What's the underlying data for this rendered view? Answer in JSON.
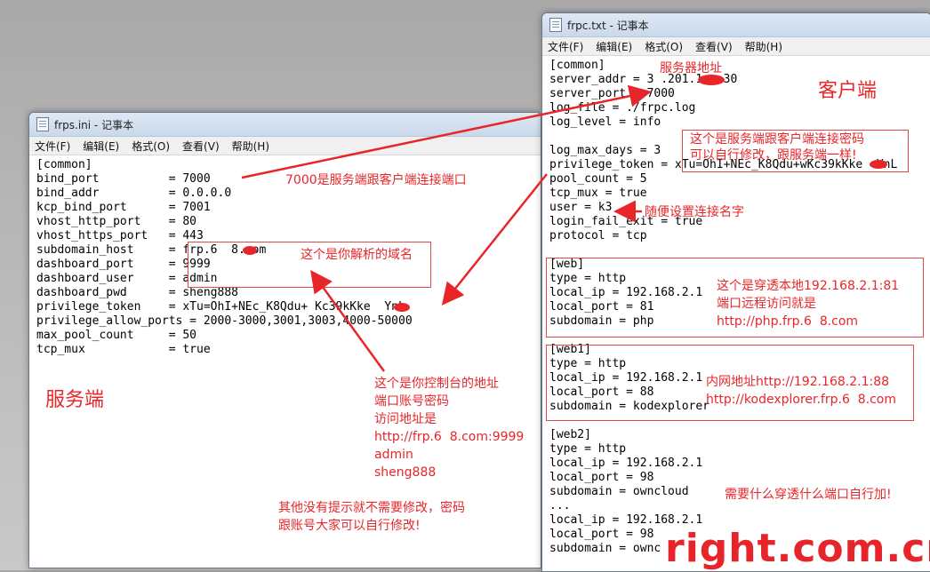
{
  "server": {
    "title": "frps.ini - 记事本",
    "menus": [
      "文件(F)",
      "编辑(E)",
      "格式(O)",
      "查看(V)",
      "帮助(H)"
    ],
    "lines": [
      "[common]",
      "bind_port          = 7000",
      "bind_addr          = 0.0.0.0",
      "kcp_bind_port      = 7001",
      "vhost_http_port    = 80",
      "vhost_https_port   = 443",
      "subdomain_host     = frp.6  8.com",
      "dashboard_port     = 9999",
      "dashboard_user     = admin",
      "dashboard_pwd      = sheng888",
      "privilege_token    = xTu=OhI+NEc_K8Qdu+ Kc39kKke  YnL",
      "privilege_allow_ports = 2000-3000,3001,3003,4000-50000",
      "max_pool_count     = 50",
      "tcp_mux            = true"
    ],
    "annotations": {
      "label": "服务端",
      "port_note": "7000是服务端跟客户端连接端口",
      "domain_note": "这个是你解析的域名",
      "console_note": "这个是你控制台的地址\n端口账号密码\n访问地址是\nhttp://frp.6  8.com:9999\nadmin\nsheng888",
      "other_note": "其他没有提示就不需要修改，密码\n跟账号大家可以自行修改!"
    }
  },
  "client": {
    "title": "frpc.txt - 记事本",
    "menus": [
      "文件(F)",
      "编辑(E)",
      "格式(O)",
      "查看(V)",
      "帮助(H)"
    ],
    "lines": [
      "[common]",
      "server_addr = 3 .201.1  .30",
      "server_port = 7000",
      "log_file = ./frpc.log",
      "log_level = info",
      "",
      "log_max_days = 3",
      "privilege_token = xTu=OhI+NEc_K8Qdu+wKc39kKke  YnL",
      "pool_count = 5",
      "tcp_mux = true",
      "user = k3",
      "login_fail_exit = true",
      "protocol = tcp",
      "",
      "[web]",
      "type = http",
      "local_ip = 192.168.2.1",
      "local_port = 81",
      "subdomain = php",
      "",
      "[web1]",
      "type = http",
      "local_ip = 192.168.2.1",
      "local_port = 88",
      "subdomain = kodexplorer",
      "",
      "[web2]",
      "type = http",
      "local_ip = 192.168.2.1",
      "local_port = 98",
      "subdomain = owncloud",
      "...",
      "local_ip = 192.168.2.1",
      "local_port = 98",
      "subdomain = ownc"
    ],
    "annotations": {
      "label": "客户端",
      "server_addr_note": "服务器地址",
      "token_note": "这个是服务端跟客户端连接密码\n可以自行修改，跟服务端一样!",
      "user_note": "随便设置连接名字",
      "web_note": "这个是穿透本地192.168.2.1:81\n端口远程访问就是\nhttp://php.frp.6  8.com",
      "web1_note": "内网地址http://192.168.2.1:88\nhttp://kodexplorer.frp.6  8.com",
      "more_note": "需要什么穿透什么端口自行加!"
    }
  },
  "watermark": "right.com.cn",
  "colors": {
    "annotation": "#e8262a",
    "titlebar": "#c9d8eb"
  }
}
